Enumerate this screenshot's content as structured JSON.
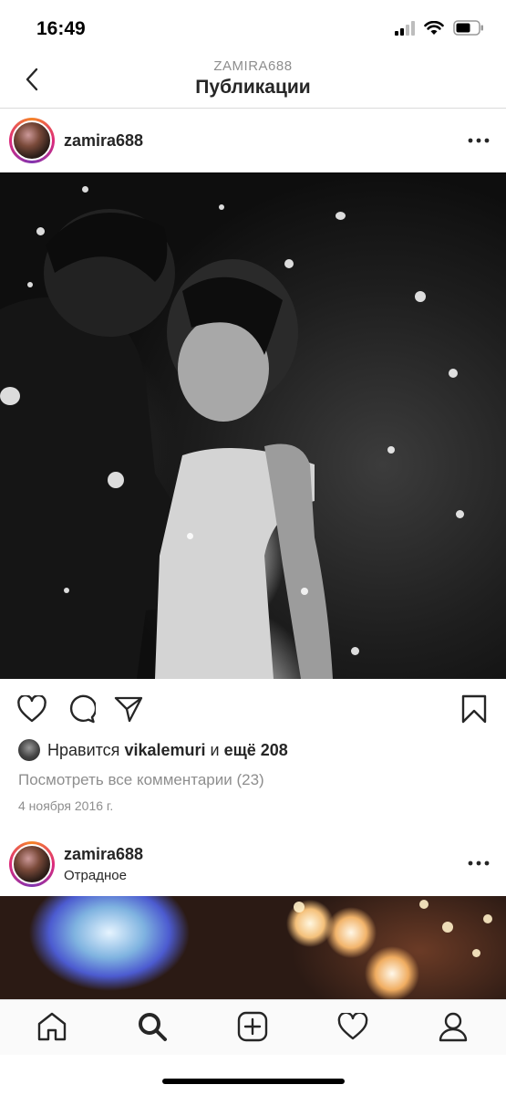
{
  "status_bar": {
    "time": "16:49"
  },
  "nav": {
    "subtitle": "ZAMIRA688",
    "title": "Публикации"
  },
  "post1": {
    "username": "zamira688",
    "likes": {
      "prefix": "Нравится ",
      "user": "vikalemuri",
      "middle": " и ",
      "count": "ещё 208"
    },
    "comments_link": "Посмотреть все комментарии (23)",
    "date": "4 ноября 2016 г."
  },
  "post2": {
    "username": "zamira688",
    "location": "Отрадное"
  },
  "icons": {
    "back": "chevron-left-icon",
    "more": "more-icon",
    "like": "heart-icon",
    "comment": "comment-icon",
    "share": "send-icon",
    "save": "bookmark-icon",
    "tabs": [
      "home-icon",
      "search-icon",
      "add-icon",
      "activity-heart-icon",
      "profile-icon"
    ]
  },
  "colors": {
    "text": "#262626",
    "secondary": "#8e8e8e",
    "divider": "#dbdbdb"
  }
}
